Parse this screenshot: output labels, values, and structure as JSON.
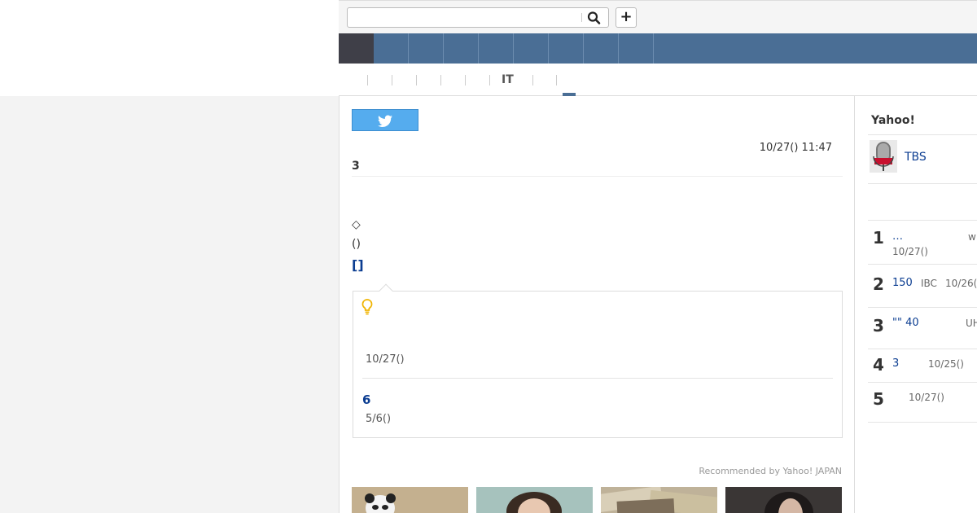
{
  "search": {
    "placeholder": "",
    "value": ""
  },
  "topbar": {
    "plus_label": "+"
  },
  "subnav": {
    "it_label": "IT"
  },
  "article": {
    "date": "10/27() 11:47",
    "headline": "3",
    "diamond_text": "◇",
    "paren_text": "()",
    "bracket_link": "[]"
  },
  "tip": {
    "date1": "10/27()",
    "related_link": "6",
    "date2": "5/6()"
  },
  "recommend_label": "Recommended by Yahoo! JAPAN",
  "sidebar": {
    "title": "Yahoo!",
    "source_link": "TBS",
    "ranking": [
      {
        "num": "1",
        "title": "…",
        "source": "w",
        "date": "10/27()"
      },
      {
        "num": "2",
        "title": "150",
        "source": "IBC",
        "date": "10/26("
      },
      {
        "num": "3",
        "title": "\"\" 40",
        "source": "UH",
        "date": ""
      },
      {
        "num": "4",
        "title": "3",
        "source": "",
        "date": "10/25()"
      },
      {
        "num": "5",
        "title": "",
        "source": "",
        "date": "10/27()"
      }
    ]
  },
  "colors": {
    "nav": "#4a6e95",
    "nav_home": "#3f3f48",
    "twitter": "#55acee",
    "link": "#0b3d91",
    "bulb": "#f0b400"
  },
  "icons": {
    "search": "search-icon",
    "twitter": "twitter-bird-icon",
    "bulb": "lightbulb-icon",
    "tbs": "news-microphone-icon"
  }
}
